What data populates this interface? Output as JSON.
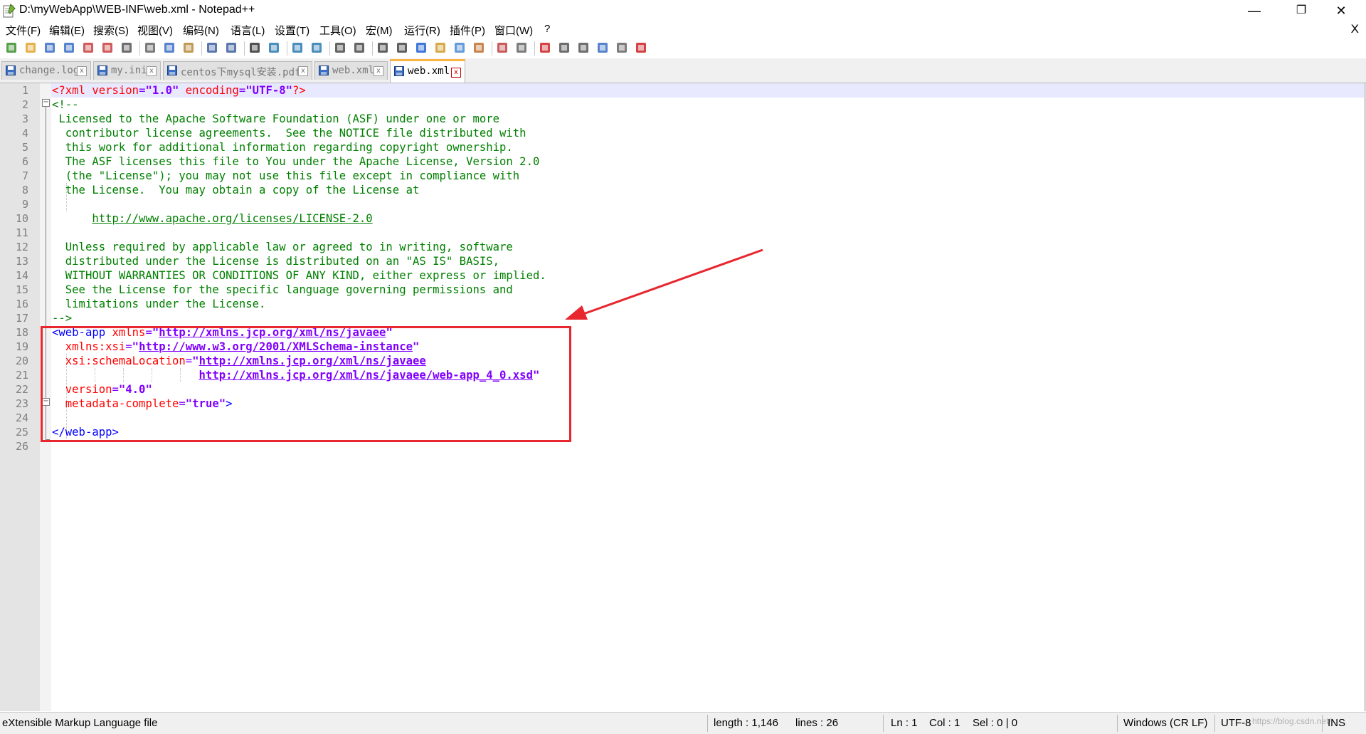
{
  "window": {
    "title": "D:\\myWebApp\\WEB-INF\\web.xml - Notepad++",
    "minimize": "—",
    "maximize": "❐",
    "close": "✕"
  },
  "menu": {
    "items": [
      "文件(F)",
      "编辑(E)",
      "搜索(S)",
      "视图(V)",
      "编码(N)",
      "语言(L)",
      "设置(T)",
      "工具(O)",
      "宏(M)",
      "运行(R)",
      "插件(P)",
      "窗口(W)",
      "?"
    ],
    "close_doc": "X"
  },
  "toolbar": {
    "icons": [
      "new-file-icon",
      "open-file-icon",
      "save-icon",
      "save-all-icon",
      "close-icon",
      "close-all-icon",
      "print-icon",
      "cut-icon",
      "copy-icon",
      "paste-icon",
      "undo-icon",
      "redo-icon",
      "find-icon",
      "replace-icon",
      "zoom-in-icon",
      "zoom-out-icon",
      "sync-vertical-icon",
      "sync-horizontal-icon",
      "word-wrap-icon",
      "show-all-chars-icon",
      "indent-guide-icon",
      "user-lang-icon",
      "doc-map-icon",
      "function-list-icon",
      "folder-workspace-icon",
      "monitor-icon",
      "record-macro-icon",
      "stop-record-icon",
      "play-macro-icon",
      "run-macro-multiple-icon",
      "save-macro-icon",
      "spellcheck-icon"
    ]
  },
  "tabs": [
    {
      "label": "change.log",
      "active": false
    },
    {
      "label": "my.ini",
      "active": false
    },
    {
      "label": "centos下mysql安装.pdf",
      "active": false
    },
    {
      "label": "web.xml",
      "active": false
    },
    {
      "label": "web.xml",
      "active": true
    }
  ],
  "editor": {
    "lines": [
      {
        "n": "1",
        "spans": [
          [
            "attr",
            "<?xml "
          ],
          [
            "attr",
            "version"
          ],
          [
            "plain",
            "="
          ],
          [
            "str",
            "\"1.0\""
          ],
          [
            "plain",
            " "
          ],
          [
            "attr",
            "encoding"
          ],
          [
            "plain",
            "="
          ],
          [
            "str",
            "\"UTF-8\""
          ],
          [
            "attr",
            "?>"
          ]
        ]
      },
      {
        "n": "2",
        "spans": [
          [
            "cmt",
            "<!--"
          ]
        ]
      },
      {
        "n": "3",
        "spans": [
          [
            "cmt",
            " Licensed to the Apache Software Foundation (ASF) under one or more"
          ]
        ]
      },
      {
        "n": "4",
        "spans": [
          [
            "cmt",
            "  contributor license agreements.  See the NOTICE file distributed with"
          ]
        ]
      },
      {
        "n": "5",
        "spans": [
          [
            "cmt",
            "  this work for additional information regarding copyright ownership."
          ]
        ]
      },
      {
        "n": "6",
        "spans": [
          [
            "cmt",
            "  The ASF licenses this file to You under the Apache License, Version 2.0"
          ]
        ]
      },
      {
        "n": "7",
        "spans": [
          [
            "cmt",
            "  (the \"License\"); you may not use this file except in compliance with"
          ]
        ]
      },
      {
        "n": "8",
        "spans": [
          [
            "cmt",
            "  the License.  You may obtain a copy of the License at"
          ]
        ]
      },
      {
        "n": "9",
        "spans": []
      },
      {
        "n": "10",
        "spans": [
          [
            "cmt",
            "      "
          ],
          [
            "url",
            "http://www.apache.org/licenses/LICENSE-2.0"
          ]
        ]
      },
      {
        "n": "11",
        "spans": []
      },
      {
        "n": "12",
        "spans": [
          [
            "cmt",
            "  Unless required by applicable law or agreed to in writing, software"
          ]
        ]
      },
      {
        "n": "13",
        "spans": [
          [
            "cmt",
            "  distributed under the License is distributed on an \"AS IS\" BASIS,"
          ]
        ]
      },
      {
        "n": "14",
        "spans": [
          [
            "cmt",
            "  WITHOUT WARRANTIES OR CONDITIONS OF ANY KIND, either express or implied."
          ]
        ]
      },
      {
        "n": "15",
        "spans": [
          [
            "cmt",
            "  See the License for the specific language governing permissions and"
          ]
        ]
      },
      {
        "n": "16",
        "spans": [
          [
            "cmt",
            "  limitations under the License."
          ]
        ]
      },
      {
        "n": "17",
        "spans": [
          [
            "cmt",
            "-->"
          ]
        ]
      },
      {
        "n": "18",
        "spans": [
          [
            "tag",
            "<web-app "
          ],
          [
            "attr",
            "xmlns"
          ],
          [
            "plain",
            "="
          ],
          [
            "str",
            "\""
          ],
          [
            "surl",
            "http://xmlns.jcp.org/xml/ns/javaee"
          ],
          [
            "str",
            "\""
          ]
        ]
      },
      {
        "n": "19",
        "spans": [
          [
            "plain",
            "  "
          ],
          [
            "attr",
            "xmlns:xsi"
          ],
          [
            "plain",
            "="
          ],
          [
            "str",
            "\""
          ],
          [
            "surl",
            "http://www.w3.org/2001/XMLSchema-instance"
          ],
          [
            "str",
            "\""
          ]
        ]
      },
      {
        "n": "20",
        "spans": [
          [
            "plain",
            "  "
          ],
          [
            "attr",
            "xsi:schemaLocation"
          ],
          [
            "plain",
            "="
          ],
          [
            "str",
            "\""
          ],
          [
            "surl",
            "http://xmlns.jcp.org/xml/ns/javaee"
          ]
        ]
      },
      {
        "n": "21",
        "spans": [
          [
            "plain",
            "                      "
          ],
          [
            "surl",
            "http://xmlns.jcp.org/xml/ns/javaee/web-app_4_0.xsd"
          ],
          [
            "str",
            "\""
          ]
        ]
      },
      {
        "n": "22",
        "spans": [
          [
            "plain",
            "  "
          ],
          [
            "attr",
            "version"
          ],
          [
            "plain",
            "="
          ],
          [
            "str",
            "\"4.0\""
          ]
        ]
      },
      {
        "n": "23",
        "spans": [
          [
            "plain",
            "  "
          ],
          [
            "attr",
            "metadata-complete"
          ],
          [
            "plain",
            "="
          ],
          [
            "str",
            "\"true\""
          ],
          [
            "tag",
            ">"
          ]
        ]
      },
      {
        "n": "24",
        "spans": []
      },
      {
        "n": "25",
        "spans": [
          [
            "tag",
            "</web-app>"
          ]
        ]
      },
      {
        "n": "26",
        "spans": []
      }
    ]
  },
  "colors": {
    "comment": "#008000",
    "tag": "#0000ff",
    "attribute": "#ff0000",
    "string": "#8000ff",
    "annotation": "#e8262e"
  },
  "status": {
    "file_type": "eXtensible Markup Language file",
    "length": "length : 1,146",
    "lines": "lines : 26",
    "ln": "Ln : 1",
    "col": "Col : 1",
    "sel": "Sel : 0 | 0",
    "eol": "Windows (CR LF)",
    "encoding": "UTF-8",
    "mode": "INS",
    "watermark": "https://blog.csdn.net/jiqiu..."
  }
}
